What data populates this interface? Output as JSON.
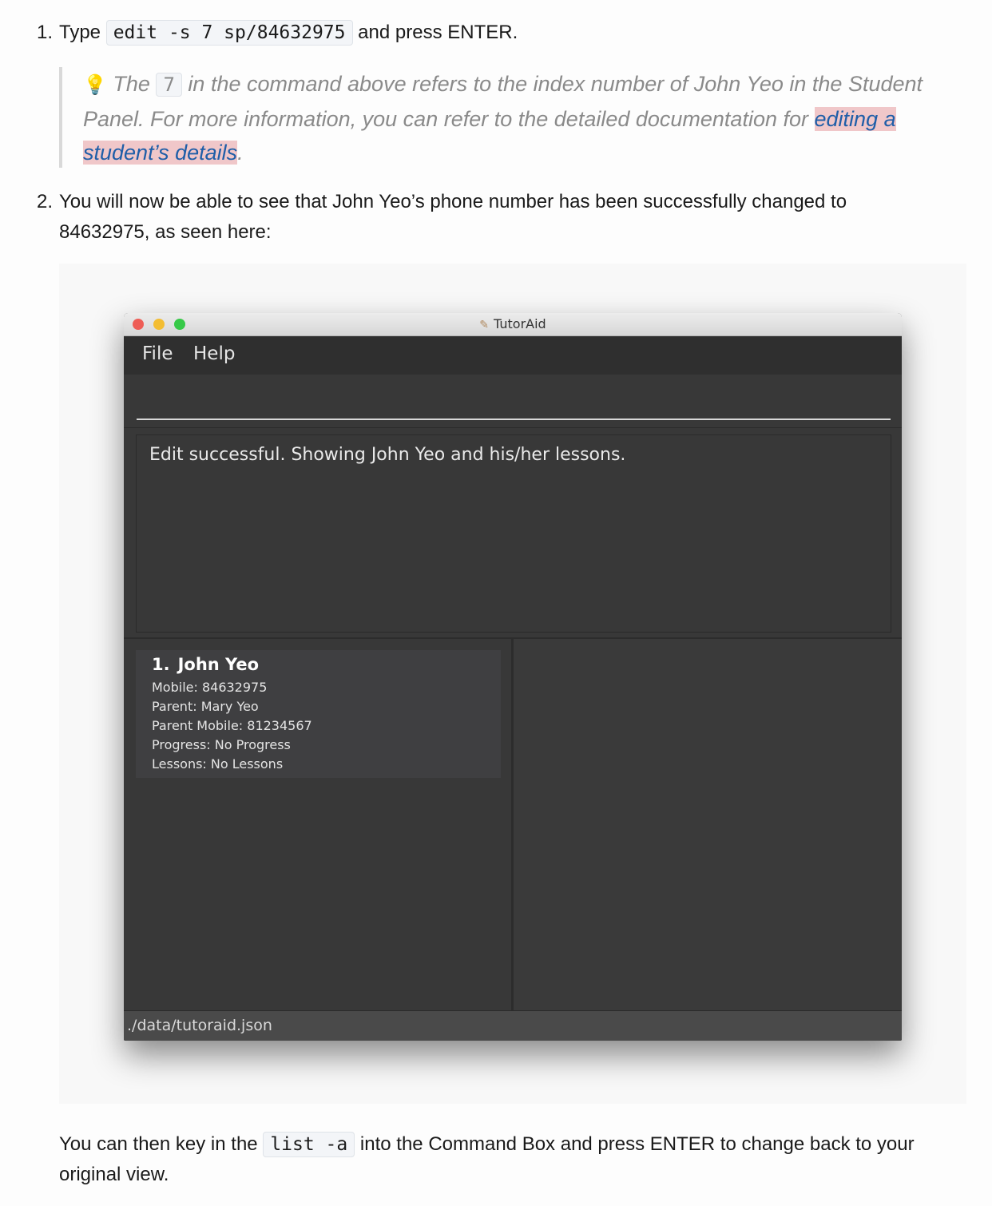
{
  "steps": [
    {
      "number": "1.",
      "prefix": "Type",
      "code": "edit -s 7 sp/84632975",
      "suffix": "and press ENTER."
    },
    {
      "number": "2.",
      "text": "You will now be able to see that John Yeo’s phone number has been successfully changed to 84632975, as seen here:"
    }
  ],
  "tip": {
    "icon": "lightbulb-icon",
    "part1": "The",
    "code": "7",
    "part2": "in the command above refers to the index number of John Yeo in the Student Panel. For more information, you can refer to the detailed documentation for",
    "link": "editing a student’s details",
    "part3": "."
  },
  "app": {
    "window_title": "TutorAid",
    "menu": [
      "File",
      "Help"
    ],
    "command_input": "",
    "result_message": "Edit successful. Showing John Yeo and his/her lessons.",
    "student": {
      "index": "1.",
      "name": "John Yeo",
      "mobile": "Mobile: 84632975",
      "parent": "Parent: Mary Yeo",
      "parent_mobile": "Parent Mobile: 81234567",
      "progress": "Progress: No Progress",
      "lessons": "Lessons: No Lessons"
    },
    "status_path": "./data/tutoraid.json"
  },
  "outro": {
    "part1": "You can then key in the",
    "code": "list -a",
    "part2": "into the Command Box and press ENTER to change back to your original view."
  },
  "colors": {
    "window_bg": "#383838",
    "link": "#1f5ea8",
    "link_highlight": "#f0c7c9",
    "traffic_red": "#ee5d56",
    "traffic_yellow": "#f3bd32",
    "traffic_green": "#37c948"
  }
}
